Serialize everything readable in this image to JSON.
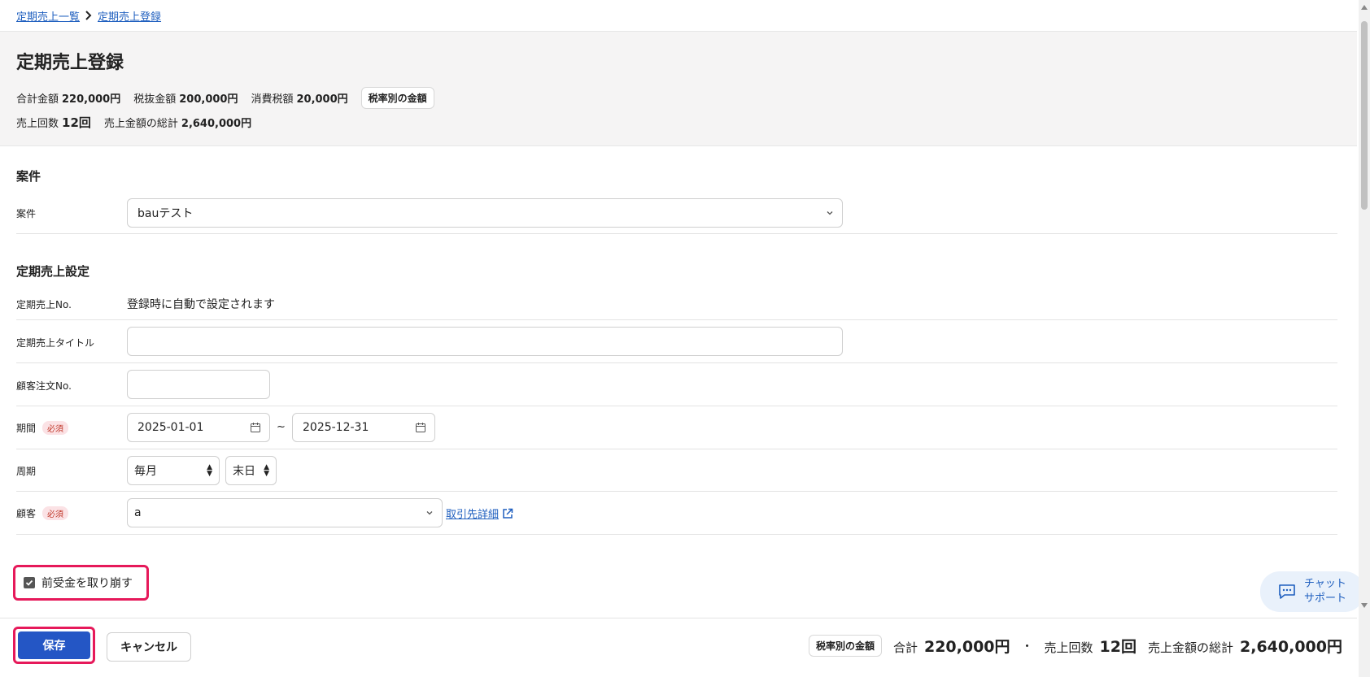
{
  "breadcrumb": {
    "items": [
      "定期売上一覧",
      "定期売上登録"
    ]
  },
  "header": {
    "title": "定期売上登録",
    "total_label": "合計金額",
    "total_value": "220,000円",
    "pretax_label": "税抜金額",
    "pretax_value": "200,000円",
    "tax_label": "消費税額",
    "tax_value": "20,000円",
    "tax_rate_button": "税率別の金額",
    "count_label": "売上回数",
    "count_value": "12回",
    "grand_label": "売上金額の総計",
    "grand_value": "2,640,000円"
  },
  "project": {
    "section_title": "案件",
    "label": "案件",
    "value": "bauテスト"
  },
  "settings": {
    "section_title": "定期売上設定",
    "no_label": "定期売上No.",
    "no_value": "登録時に自動で設定されます",
    "title_label": "定期売上タイトル",
    "title_value": "",
    "order_label": "顧客注文No.",
    "order_value": "",
    "period_label": "期間",
    "required": "必須",
    "period_start": "2025-01-01",
    "period_sep": "~",
    "period_end": "2025-12-31",
    "cycle_label": "周期",
    "cycle_value": "毎月",
    "cycle_day": "末日",
    "customer_label": "顧客",
    "customer_value": "a",
    "customer_link": "取引先詳細"
  },
  "advance": {
    "checked": true,
    "label": "前受金を取り崩す"
  },
  "footer": {
    "save": "保存",
    "cancel": "キャンセル",
    "tax_rate_button": "税率別の金額",
    "total_label": "合計",
    "total_value": "220,000円",
    "separator": "・",
    "count_label": "売上回数",
    "count_value": "12回",
    "grand_label": "売上金額の総計",
    "grand_value": "2,640,000円"
  },
  "chat": {
    "line1": "チャット",
    "line2": "サポート"
  },
  "colors": {
    "primary": "#2456c5",
    "link": "#1f5fbf",
    "highlight": "#e6195a",
    "required_bg": "#fbe2e5"
  }
}
